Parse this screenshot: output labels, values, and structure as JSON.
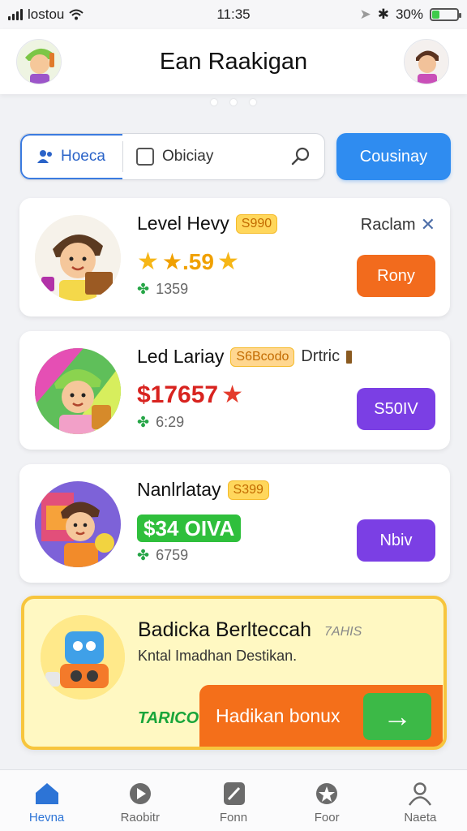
{
  "status_bar": {
    "carrier": "lostou",
    "time": "11:35",
    "battery": "30%",
    "battery_level": 0.3
  },
  "header": {
    "title": "Ean Raakigan"
  },
  "segment": {
    "active_label": "Hoeca",
    "other_label": "Obiciay",
    "button_label": "Cousinay"
  },
  "cards": [
    {
      "title": "Level Hevy",
      "badge": "S990",
      "meta": "Raclam",
      "rating": "★.59",
      "count": "1359",
      "button": "Rony",
      "button_color": "#f26b1d"
    },
    {
      "title": "Led Lariay",
      "badge": "S6Bcodo",
      "meta": "Drtric",
      "price": "$17657",
      "count": "6:29",
      "button": "S50IV",
      "button_color": "#7b3fe4"
    },
    {
      "title": "Nanlrlatay",
      "badge": "S399",
      "price": "$34 OIVA",
      "count": "6759",
      "button": "Nbiv",
      "button_color": "#7b3fe4"
    }
  ],
  "promo": {
    "title": "Badicka Berlteccah",
    "badge": "7AHIS",
    "subtitle": "Kntal Imadhan Destikan.",
    "code": "TARICO",
    "cta": "Hadikan bonux",
    "arrow": "→"
  },
  "nav": [
    {
      "label": "Hevna",
      "icon": "home-icon"
    },
    {
      "label": "Raobitr",
      "icon": "play-icon"
    },
    {
      "label": "Fonn",
      "icon": "pencil-icon"
    },
    {
      "label": "Foor",
      "icon": "star-icon"
    },
    {
      "label": "Naeta",
      "icon": "profile-icon"
    }
  ]
}
